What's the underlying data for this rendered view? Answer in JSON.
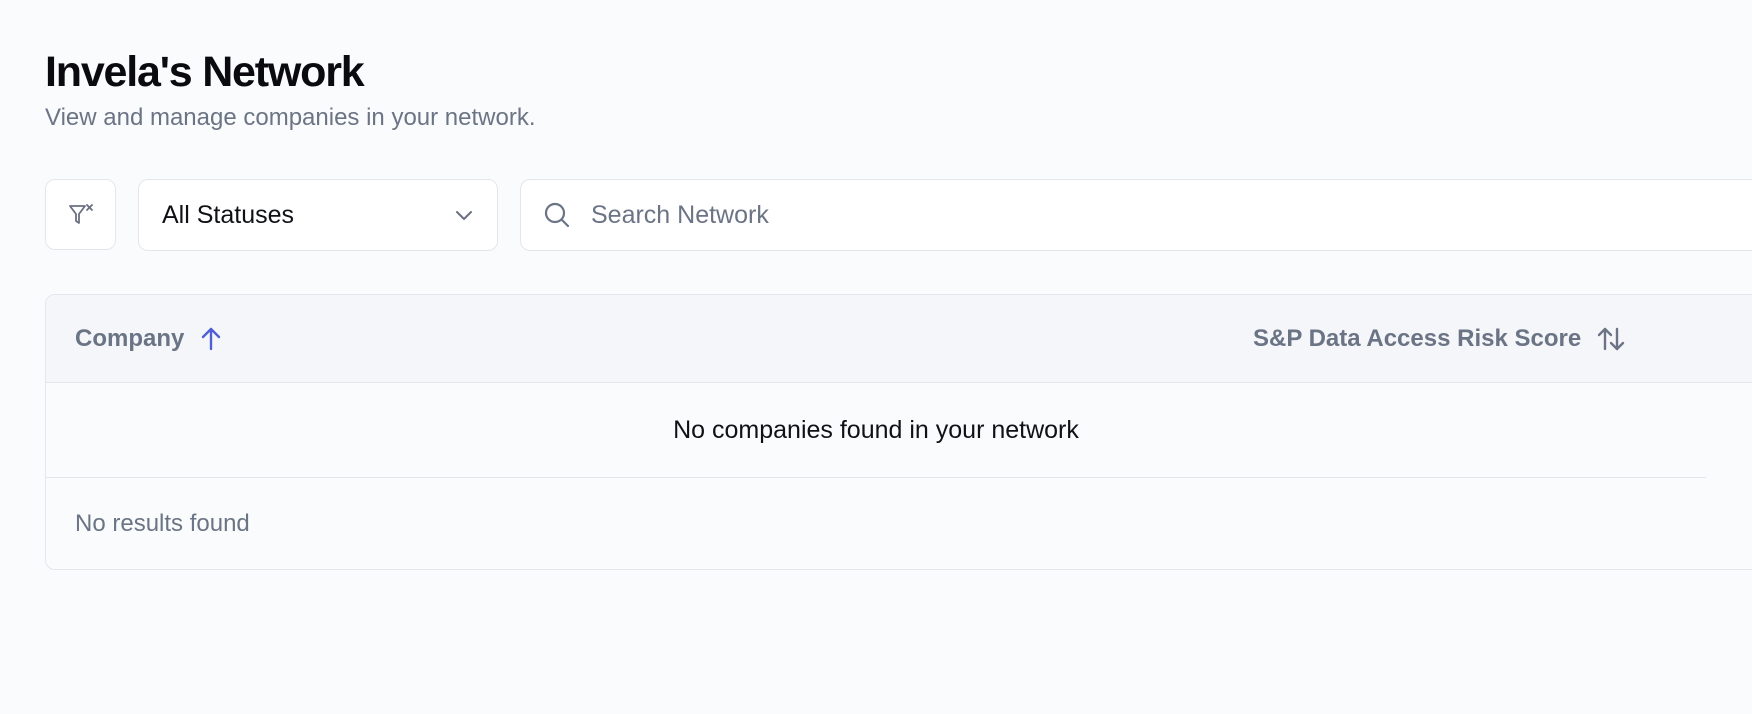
{
  "header": {
    "title": "Invela's Network",
    "subtitle": "View and manage companies in your network."
  },
  "filters": {
    "clear_icon": "filter-x-icon",
    "status_select": {
      "value": "All Statuses",
      "icon": "chevron-down-icon"
    },
    "search": {
      "placeholder": "Search Network",
      "value": "",
      "icon": "search-icon"
    }
  },
  "table": {
    "columns": [
      {
        "label": "Company",
        "sort": "ascending",
        "sort_icon": "arrow-up-icon"
      },
      {
        "label": "S&P Data Access Risk Score",
        "sort": "none",
        "sort_icon": "sort-arrows-icon"
      }
    ],
    "empty_message": "No companies found in your network",
    "footer_text": "No results found"
  },
  "colors": {
    "accent": "#4f5fd6",
    "muted_text": "#6b7485",
    "border": "#e4e6ec",
    "background": "#fafbfd"
  }
}
